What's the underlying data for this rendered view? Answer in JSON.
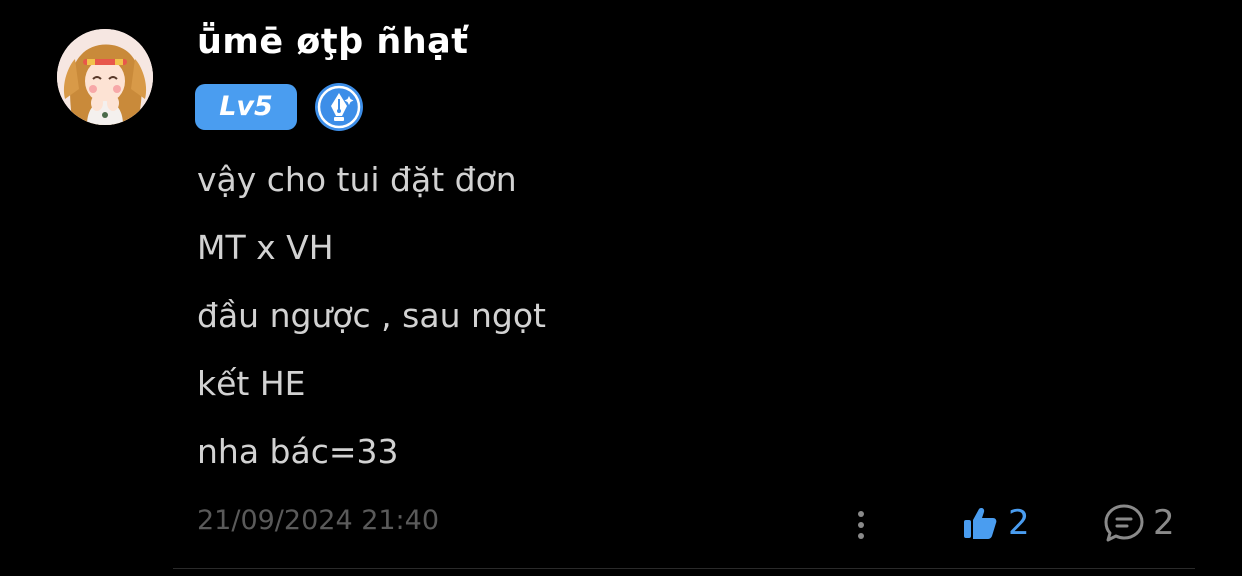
{
  "comment": {
    "user": {
      "name": "ṻmē øţþ ñhạť",
      "level_badge": "Lv5",
      "avatar_icon": "cartoon-girl-avatar",
      "writer_badge_icon": "pen-nib-badge-icon"
    },
    "lines": [
      "vậy cho tui đặt đơn",
      "MT x VH",
      "đầu ngược , sau ngọt",
      "kết HE",
      "nha bác=33"
    ],
    "timestamp": "21/09/2024 21:40",
    "actions": {
      "more_icon": "vertical-ellipsis-icon",
      "like_icon": "thumbs-up-icon",
      "like_count": "2",
      "reply_icon": "speech-bubble-icon",
      "reply_count": "2"
    }
  },
  "colors": {
    "background": "#000000",
    "accent": "#4a9df0",
    "text": "#d2d2d2",
    "muted": "#5a5a5a"
  }
}
